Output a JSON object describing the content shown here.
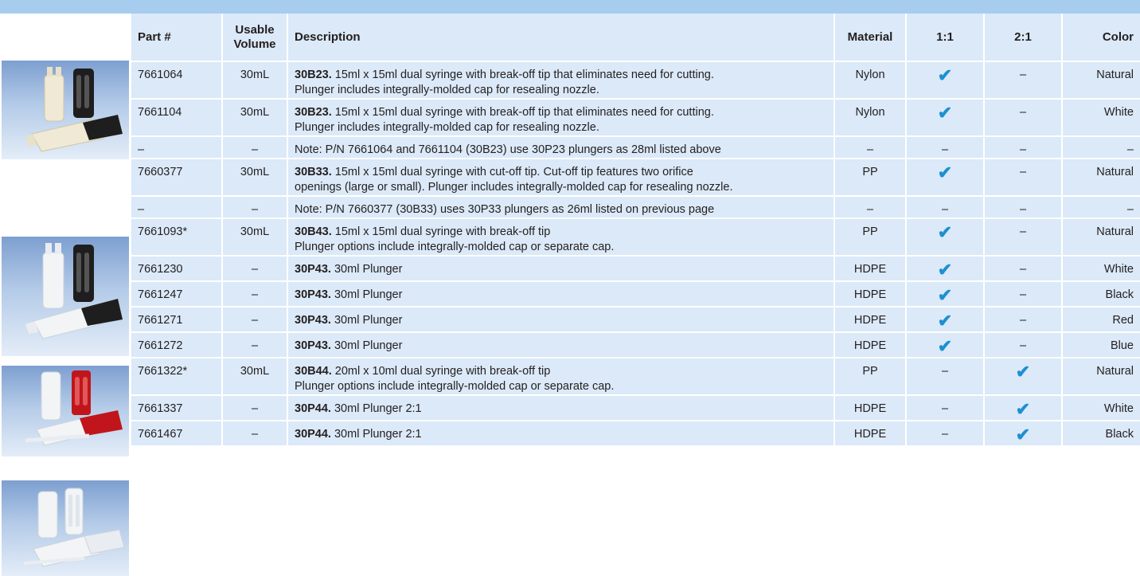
{
  "headers": {
    "part": "Part #",
    "volume": "Usable\nVolume",
    "description": "Description",
    "material": "Material",
    "ratio11": "1:1",
    "ratio21": "2:1",
    "color": "Color"
  },
  "check_symbol": "✔",
  "dash_symbol": "–",
  "rows": [
    {
      "part": "7661064",
      "volume": "30mL",
      "code": "30B23.",
      "desc": " 15ml x 15ml dual syringe with break-off tip that eliminates need for cutting.",
      "desc2": "Plunger includes integrally-molded cap for resealing nozzle.",
      "material": "Nylon",
      "r11": "✔",
      "r21": "–",
      "color": "Natural"
    },
    {
      "part": "7661104",
      "volume": "30mL",
      "code": "30B23.",
      "desc": " 15ml x 15ml dual syringe with break-off tip that eliminates need for cutting.",
      "desc2": "Plunger includes integrally-molded cap for resealing nozzle.",
      "material": "Nylon",
      "r11": "✔",
      "r21": "–",
      "color": "White"
    },
    {
      "part": "–",
      "volume": "–",
      "code": "",
      "desc": "Note: P/N 7661064 and 7661104 (30B23) use 30P23 plungers as 28ml listed above",
      "desc2": "",
      "material": "–",
      "r11": "–",
      "r21": "–",
      "color": "–"
    },
    {
      "part": "7660377",
      "volume": "30mL",
      "code": "30B33.",
      "desc": " 15ml x 15ml dual syringe with cut-off tip. Cut-off tip features two orifice",
      "desc2": "openings (large or small). Plunger includes integrally-molded cap for resealing nozzle.",
      "material": "PP",
      "r11": "✔",
      "r21": "–",
      "color": "Natural"
    },
    {
      "part": "–",
      "volume": "–",
      "code": "",
      "desc": "Note: P/N 7660377 (30B33) uses 30P33 plungers as 26ml listed on previous page",
      "desc2": "",
      "material": "–",
      "r11": "–",
      "r21": "–",
      "color": "–"
    },
    {
      "part": "7661093*",
      "volume": "30mL",
      "code": "30B43.",
      "desc": " 15ml x 15ml dual syringe with break-off tip",
      "desc2": "Plunger options include integrally-molded cap or separate cap.",
      "material": "PP",
      "r11": "✔",
      "r21": "–",
      "color": "Natural"
    },
    {
      "part": "7661230",
      "volume": "–",
      "code": "30P43.",
      "desc": " 30ml Plunger",
      "desc2": "",
      "material": "HDPE",
      "r11": "✔",
      "r21": "–",
      "color": "White"
    },
    {
      "part": "7661247",
      "volume": "–",
      "code": "30P43.",
      "desc": " 30ml Plunger",
      "desc2": "",
      "material": "HDPE",
      "r11": "✔",
      "r21": "–",
      "color": "Black"
    },
    {
      "part": "7661271",
      "volume": "–",
      "code": "30P43.",
      "desc": " 30ml Plunger",
      "desc2": "",
      "material": "HDPE",
      "r11": "✔",
      "r21": "–",
      "color": "Red"
    },
    {
      "part": "7661272",
      "volume": "–",
      "code": "30P43.",
      "desc": " 30ml Plunger",
      "desc2": "",
      "material": "HDPE",
      "r11": "✔",
      "r21": "–",
      "color": "Blue"
    },
    {
      "part": "7661322*",
      "volume": "30mL",
      "code": "30B44.",
      "desc": " 20ml x 10ml dual syringe with break-off tip",
      "desc2": "Plunger options include integrally-molded cap or separate cap.",
      "material": "PP",
      "r11": "–",
      "r21": "✔",
      "color": "Natural"
    },
    {
      "part": "7661337",
      "volume": "–",
      "code": "30P44.",
      "desc": " 30ml Plunger 2:1",
      "desc2": "",
      "material": "HDPE",
      "r11": "–",
      "r21": "✔",
      "color": "White"
    },
    {
      "part": "7661467",
      "volume": "–",
      "code": "30P44.",
      "desc": " 30ml Plunger 2:1",
      "desc2": "",
      "material": "HDPE",
      "r11": "–",
      "r21": "✔",
      "color": "Black"
    }
  ],
  "photos": [
    {
      "name": "photo-30b23-syringes",
      "accent": "#1e1e1e",
      "barrel": "#efe9d6"
    },
    {
      "name": "photo-30b33-syringes",
      "accent": "#1e1e1e",
      "barrel": "#f2f4f6"
    },
    {
      "name": "photo-30p43-plungers",
      "accent": "#c0161b",
      "barrel": "#f2f4f6"
    },
    {
      "name": "photo-30b44-syringes",
      "accent": "#f2f4f6",
      "barrel": "#f2f4f6"
    }
  ],
  "colors": {
    "header_bar": "#a7cdee",
    "cell_bg": "#dbe9f8",
    "check": "#1e8fd2"
  }
}
